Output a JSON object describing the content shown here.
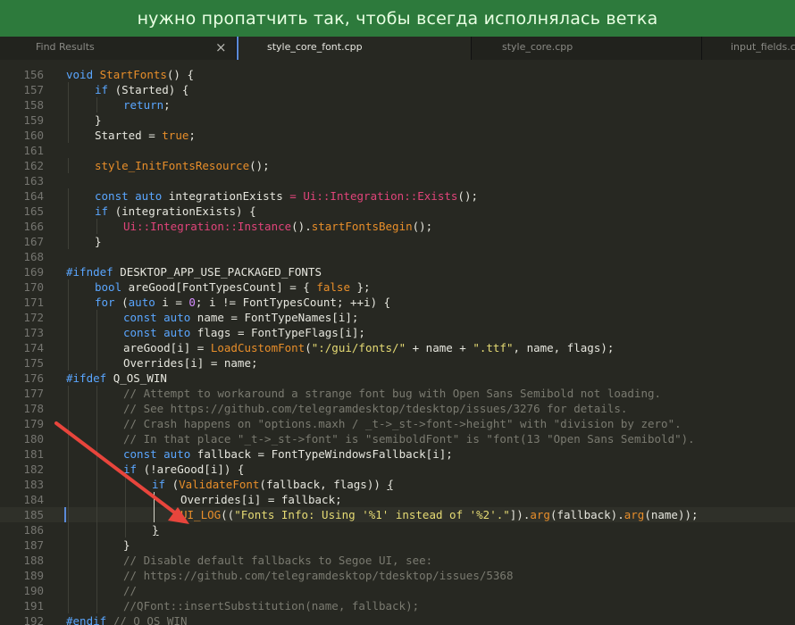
{
  "banner": {
    "text": "нужно пропатчить так, чтобы всегда исполнялась ветка"
  },
  "tabs": {
    "find_results": "Find Results",
    "close_symbol": "×",
    "active": "style_core_font.cpp",
    "core": "style_core.cpp",
    "input": "input_fields.cpp"
  },
  "colors": {
    "banner": "#2d7a3c",
    "background": "#272822",
    "keyword": "#5aa6ff",
    "function": "#e88e2a",
    "namespace": "#e0447a",
    "string": "#e6db74",
    "comment": "#7a7a70",
    "arrow": "#e8453c"
  },
  "editor": {
    "first_line": 156,
    "current_line": 185,
    "lines": [
      {
        "n": "156",
        "indent": 0,
        "t": [
          [
            "kw",
            "void "
          ],
          [
            "fn",
            "StartFonts"
          ],
          [
            "",
            "() {"
          ]
        ]
      },
      {
        "n": "157",
        "indent": 1,
        "t": [
          [
            "kw",
            "if "
          ],
          [
            "",
            "(Started) {"
          ]
        ]
      },
      {
        "n": "158",
        "indent": 2,
        "t": [
          [
            "kw",
            "return"
          ],
          [
            "",
            ";"
          ]
        ]
      },
      {
        "n": "159",
        "indent": 1,
        "t": [
          [
            "",
            "}"
          ]
        ]
      },
      {
        "n": "160",
        "indent": 1,
        "t": [
          [
            "",
            "Started = "
          ],
          [
            "bool",
            "true"
          ],
          [
            "",
            ";"
          ]
        ]
      },
      {
        "n": "161",
        "indent": 0,
        "t": []
      },
      {
        "n": "162",
        "indent": 1,
        "t": [
          [
            "fn",
            "style_InitFontsResource"
          ],
          [
            "",
            "();"
          ]
        ]
      },
      {
        "n": "163",
        "indent": 0,
        "t": []
      },
      {
        "n": "164",
        "indent": 1,
        "t": [
          [
            "kw",
            "const auto "
          ],
          [
            "",
            "integrationExists "
          ],
          [
            "ns",
            "= Ui::Integration::Exists"
          ],
          [
            "",
            "();"
          ]
        ]
      },
      {
        "n": "165",
        "indent": 1,
        "t": [
          [
            "kw",
            "if "
          ],
          [
            "",
            "(integrationExists) {"
          ]
        ]
      },
      {
        "n": "166",
        "indent": 2,
        "t": [
          [
            "ns",
            "Ui::Integration::Instance"
          ],
          [
            "",
            "()."
          ],
          [
            "fn",
            "startFontsBegin"
          ],
          [
            "",
            "();"
          ]
        ]
      },
      {
        "n": "167",
        "indent": 1,
        "t": [
          [
            "",
            "}"
          ]
        ]
      },
      {
        "n": "168",
        "indent": 0,
        "t": []
      },
      {
        "n": "169",
        "indent": 0,
        "t": [
          [
            "pp",
            "#ifndef "
          ],
          [
            "",
            "DESKTOP_APP_USE_PACKAGED_FONTS"
          ]
        ]
      },
      {
        "n": "170",
        "indent": 1,
        "t": [
          [
            "kw",
            "bool "
          ],
          [
            "",
            "areGood[FontTypesCount] = { "
          ],
          [
            "bool",
            "false"
          ],
          [
            "",
            " };"
          ]
        ]
      },
      {
        "n": "171",
        "indent": 1,
        "t": [
          [
            "kw",
            "for "
          ],
          [
            "",
            "("
          ],
          [
            "kw",
            "auto "
          ],
          [
            "",
            "i = "
          ],
          [
            "num",
            "0"
          ],
          [
            "",
            "; i != FontTypesCount; ++i) {"
          ]
        ]
      },
      {
        "n": "172",
        "indent": 2,
        "t": [
          [
            "kw",
            "const auto "
          ],
          [
            "",
            "name = FontTypeNames[i];"
          ]
        ]
      },
      {
        "n": "173",
        "indent": 2,
        "t": [
          [
            "kw",
            "const auto "
          ],
          [
            "",
            "flags = FontTypeFlags[i];"
          ]
        ]
      },
      {
        "n": "174",
        "indent": 2,
        "t": [
          [
            "",
            "areGood[i] = "
          ],
          [
            "fn",
            "LoadCustomFont"
          ],
          [
            "",
            "("
          ],
          [
            "str",
            "\":/gui/fonts/\""
          ],
          [
            "",
            " + name + "
          ],
          [
            "str",
            "\".ttf\""
          ],
          [
            "",
            ", name, flags);"
          ]
        ]
      },
      {
        "n": "175",
        "indent": 2,
        "t": [
          [
            "",
            "Overrides[i] = name;"
          ]
        ]
      },
      {
        "n": "176",
        "indent": 0,
        "t": [
          [
            "pp",
            "#ifdef "
          ],
          [
            "",
            "Q_OS_WIN"
          ]
        ]
      },
      {
        "n": "177",
        "indent": 2,
        "t": [
          [
            "cm",
            "// Attempt to workaround a strange font bug with Open Sans Semibold not loading."
          ]
        ]
      },
      {
        "n": "178",
        "indent": 2,
        "t": [
          [
            "cm",
            "// See https://github.com/telegramdesktop/tdesktop/issues/3276 for details."
          ]
        ]
      },
      {
        "n": "179",
        "indent": 2,
        "t": [
          [
            "cm",
            "// Crash happens on \"options.maxh / _t->_st->font->height\" with \"division by zero\"."
          ]
        ]
      },
      {
        "n": "180",
        "indent": 2,
        "t": [
          [
            "cm",
            "// In that place \"_t->_st->font\" is \"semiboldFont\" is \"font(13 \"Open Sans Semibold\")."
          ]
        ]
      },
      {
        "n": "181",
        "indent": 2,
        "t": [
          [
            "kw",
            "const auto "
          ],
          [
            "",
            "fallback = FontTypeWindowsFallback[i];"
          ]
        ]
      },
      {
        "n": "182",
        "indent": 2,
        "t": [
          [
            "kw",
            "if "
          ],
          [
            "",
            "(!areGood[i]) {"
          ]
        ]
      },
      {
        "n": "183",
        "indent": 3,
        "t": [
          [
            "kw",
            "if "
          ],
          [
            "",
            "("
          ],
          [
            "fn",
            "ValidateFont"
          ],
          [
            "",
            "(fallback, flags)) "
          ],
          [
            "uline",
            "{"
          ]
        ]
      },
      {
        "n": "184",
        "indent": 4,
        "t": [
          [
            "",
            "Overrides[i] = fallback;"
          ]
        ]
      },
      {
        "n": "185",
        "indent": 4,
        "t": [
          [
            "fn",
            "UI_LOG"
          ],
          [
            "",
            "(("
          ],
          [
            "str",
            "\"Fonts Info: Using '%1' instead of '%2'.\""
          ],
          [
            "",
            "])."
          ],
          [
            "fn",
            "arg"
          ],
          [
            "",
            "(fallback)."
          ],
          [
            "fn",
            "arg"
          ],
          [
            "",
            "(name));"
          ]
        ]
      },
      {
        "n": "186",
        "indent": 3,
        "t": [
          [
            "uline",
            "}"
          ]
        ]
      },
      {
        "n": "187",
        "indent": 2,
        "t": [
          [
            "",
            "}"
          ]
        ]
      },
      {
        "n": "188",
        "indent": 2,
        "t": [
          [
            "cm",
            "// Disable default fallbacks to Segoe UI, see:"
          ]
        ]
      },
      {
        "n": "189",
        "indent": 2,
        "t": [
          [
            "cm",
            "// https://github.com/telegramdesktop/tdesktop/issues/5368"
          ]
        ]
      },
      {
        "n": "190",
        "indent": 2,
        "t": [
          [
            "cm",
            "//"
          ]
        ]
      },
      {
        "n": "191",
        "indent": 2,
        "t": [
          [
            "cm",
            "//QFont::insertSubstitution(name, fallback);"
          ]
        ]
      },
      {
        "n": "192",
        "indent": 0,
        "t": [
          [
            "pp",
            "#endif "
          ],
          [
            "cm",
            "// Q_OS_WIN"
          ]
        ]
      }
    ]
  }
}
